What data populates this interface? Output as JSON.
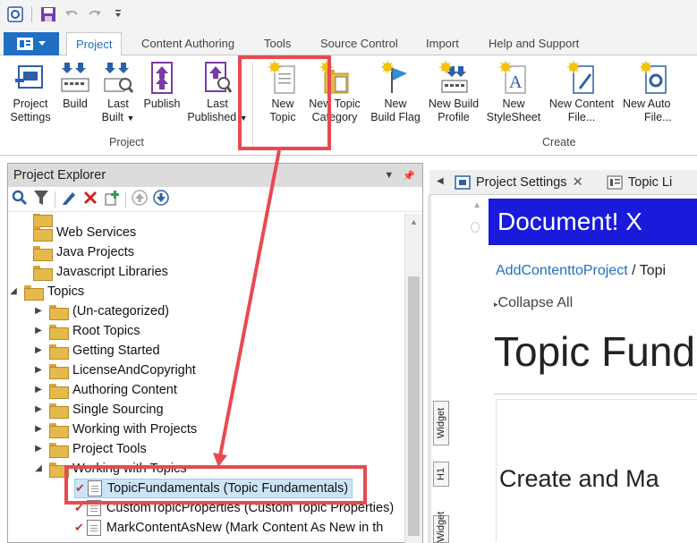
{
  "quick_access": {
    "icons": [
      "app-icon",
      "save-icon",
      "undo-icon",
      "redo-icon",
      "customize-icon"
    ]
  },
  "ribbon_tabs": [
    {
      "label": "Project"
    },
    {
      "label": "Content Authoring"
    },
    {
      "label": "Tools"
    },
    {
      "label": "Source Control"
    },
    {
      "label": "Import"
    },
    {
      "label": "Help and Support"
    }
  ],
  "ribbon": {
    "groups": {
      "project": "Project",
      "create": "Create"
    },
    "buttons": {
      "project_settings": [
        "Project",
        "Settings"
      ],
      "build": [
        "Build",
        ""
      ],
      "last_built": [
        "Last",
        "Built"
      ],
      "publish": [
        "Publish",
        ""
      ],
      "last_published": [
        "Last",
        "Published"
      ],
      "new_topic": [
        "New",
        "Topic"
      ],
      "new_topic_category": [
        "New Topic",
        "Category"
      ],
      "new_build_flag": [
        "New",
        "Build Flag"
      ],
      "new_build_profile": [
        "New Build",
        "Profile"
      ],
      "new_stylesheet": [
        "New",
        "StyleSheet"
      ],
      "new_content_file": [
        "New Content",
        "File..."
      ],
      "new_auto": [
        "New Auto",
        "File..."
      ]
    }
  },
  "explorer": {
    "title": "Project Explorer",
    "items": [
      {
        "label": "Web Services"
      },
      {
        "label": "Java Projects"
      },
      {
        "label": "Javascript Libraries"
      },
      {
        "label": "Topics"
      },
      {
        "label": "(Un-categorized)"
      },
      {
        "label": "Root Topics"
      },
      {
        "label": "Getting Started"
      },
      {
        "label": "LicenseAndCopyright"
      },
      {
        "label": "Authoring Content"
      },
      {
        "label": "Single Sourcing"
      },
      {
        "label": "Working with Projects"
      },
      {
        "label": "Project Tools"
      },
      {
        "label": "Working with Topics"
      },
      {
        "label": "TopicFundamentals (Topic Fundamentals)"
      },
      {
        "label": "CustomTopicProperties (Custom Topic Properties)"
      },
      {
        "label": "MarkContentAsNew (Mark Content As New in th"
      }
    ]
  },
  "doc_tabs": [
    {
      "label": "Project Settings"
    },
    {
      "label": "Topic Li"
    }
  ],
  "document": {
    "banner": "Document! X",
    "breadcrumb_link": "AddContenttoProject",
    "breadcrumb_rest": " / Topi",
    "collapse_all": "Collapse All",
    "heading": "Topic Fund",
    "subheading": "Create and Ma",
    "widget_labels": [
      "Widget",
      "H1",
      "Widget"
    ]
  },
  "colors": {
    "accent": "#1f6fc3",
    "banner": "#1a1adb",
    "annotation": "#e84a4f",
    "selected_row": "#cce4f7"
  }
}
